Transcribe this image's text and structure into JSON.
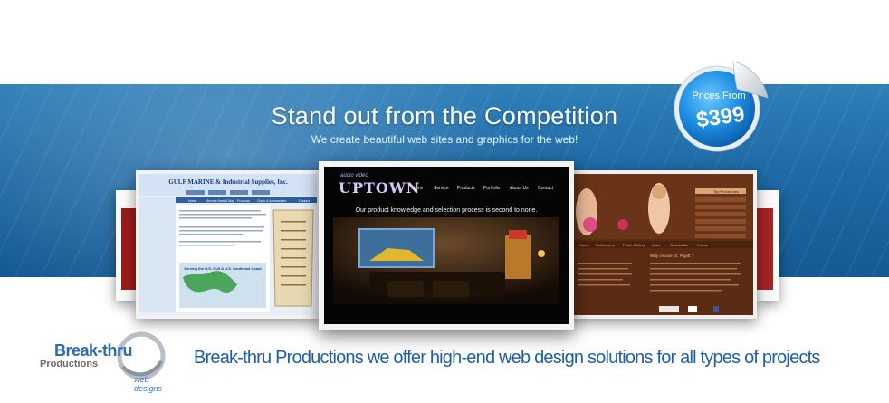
{
  "hero": {
    "headline": "Stand out from the Competition",
    "subline": "We create beautiful web sites and graphics for the web!"
  },
  "price_sticker": {
    "label": "Prices From",
    "price": "$399"
  },
  "showcase": {
    "gulf_marine": {
      "title": "GULF MARINE & Industrial Supplies, Inc.",
      "nav": [
        "Home",
        "Service Area & Map",
        "Products",
        "Chain & Accessories",
        "Contact"
      ],
      "map_caption": "Serving the U.S. Gulf & U.S. Southeast Coast"
    },
    "uptown": {
      "logo": "UPTOWN",
      "logo_tag": "audio video",
      "nav": [
        "Home",
        "Service",
        "Products",
        "Portfolio",
        "About Us",
        "Contact"
      ],
      "tagline": "Our product knowledge and selection process is second to none."
    },
    "cosmetic": {
      "sidebar_title": "Top Procedures",
      "nav": [
        "Home",
        "Procedures",
        "Photo Gallery",
        "Links",
        "Contact Us",
        "Forms"
      ],
      "heading": "Why choose Dr. Pigott ?"
    }
  },
  "brand": {
    "line1": "Break-thru",
    "line2": "Productions",
    "line3": "web designs",
    "tagline": "Break-thru Productions we offer high-end web design solutions for all types of projects"
  },
  "colors": {
    "banner": "#1f6aa6",
    "brand_blue": "#1e5ea8"
  }
}
